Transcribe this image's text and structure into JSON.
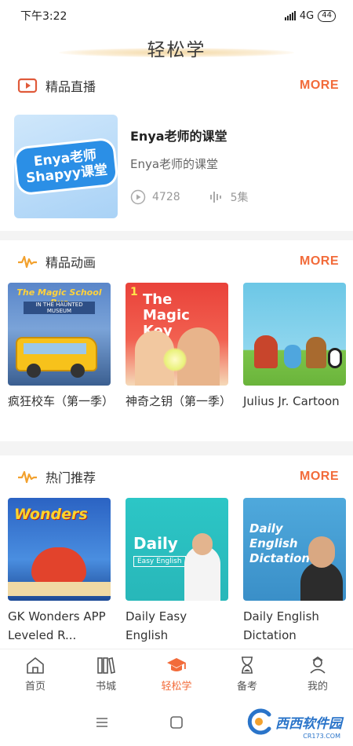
{
  "status": {
    "time": "下午3:22",
    "network": "4G",
    "battery": "44"
  },
  "header": {
    "title": "轻松学"
  },
  "live": {
    "title": "精品直播",
    "more": "MORE",
    "course": {
      "logo_line1": "Enya老师",
      "logo_line2": "Shapyy课堂",
      "title": "Enya老师的课堂",
      "subtitle": "Enya老师的课堂",
      "plays": "4728",
      "episodes": "5集"
    }
  },
  "animation": {
    "title": "精品动画",
    "more": "MORE",
    "items": [
      {
        "caption": "疯狂校车（第一季）",
        "art_text": "The Magic School Bus",
        "art_sub": "IN THE HAUNTED MUSEUM"
      },
      {
        "caption": "神奇之钥（第一季）",
        "art_text": "The Magic Key",
        "art_sub": "1"
      },
      {
        "caption": "Julius Jr. Cartoon"
      }
    ]
  },
  "recommend": {
    "title": "热门推荐",
    "more": "MORE",
    "items": [
      {
        "caption": "GK Wonders APP Leveled R...",
        "art_text": "Wonders"
      },
      {
        "caption": "Daily Easy English",
        "art_text": "Daily",
        "art_sub": "Easy English"
      },
      {
        "caption": "Daily English Dictation",
        "art_text": "Daily English Dictation"
      }
    ]
  },
  "tabs": [
    {
      "label": "首页",
      "icon": "home-icon"
    },
    {
      "label": "书城",
      "icon": "books-icon"
    },
    {
      "label": "轻松学",
      "icon": "graduation-cap-icon",
      "active": true
    },
    {
      "label": "备考",
      "icon": "hourglass-icon"
    },
    {
      "label": "我的",
      "icon": "user-icon"
    }
  ],
  "watermark": {
    "text": "西西软件园",
    "sub": "CR173.COM"
  },
  "colors": {
    "accent": "#f26b3a",
    "background": "#f4f4f4"
  }
}
